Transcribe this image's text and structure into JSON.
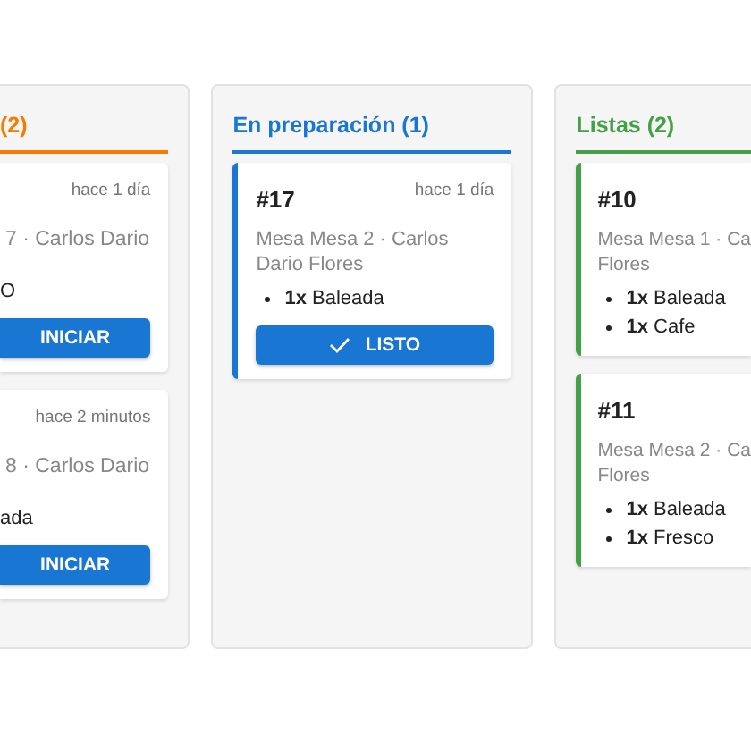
{
  "columns": [
    {
      "title": "(2)",
      "color": "#f57c00",
      "kind": "cut-left",
      "cards": [
        {
          "time": "hace 1 día",
          "table": "7 · Carlos Dario",
          "items": [
            {
              "text": "O",
              "bullet": false
            }
          ],
          "action": {
            "label": "INICIAR",
            "kind": "start"
          }
        },
        {
          "time": "hace 2 minutos",
          "table": "8 · Carlos Dario",
          "items": [
            {
              "text": "ada",
              "bullet": false
            }
          ],
          "action": {
            "label": "INICIAR",
            "kind": "start"
          }
        }
      ]
    },
    {
      "title": "En preparación (1)",
      "color": "#1976d2",
      "kind": "full",
      "cards": [
        {
          "number": "#17",
          "time": "hace 1 día",
          "table": "Mesa Mesa 2 · Carlos Dario Flores",
          "items": [
            {
              "text": "**1x** Baleada",
              "bullet": true
            }
          ],
          "action": {
            "label": "LISTO",
            "kind": "done"
          }
        }
      ]
    },
    {
      "title": "Listas (2)",
      "color": "#43a047",
      "kind": "cut-right",
      "cards": [
        {
          "number": "#10",
          "table": "Mesa Mesa 1 · Ca",
          "table_line2": "Flores",
          "items": [
            {
              "text": "**1x** Baleada",
              "bullet": true
            },
            {
              "text": "**1x** Cafe",
              "bullet": true
            }
          ]
        },
        {
          "number": "#11",
          "table": "Mesa Mesa 2 · Ca",
          "table_line2": "Flores",
          "items": [
            {
              "text": "**1x** Baleada",
              "bullet": true
            },
            {
              "text": "**1x** Fresco",
              "bullet": true
            }
          ]
        }
      ]
    }
  ]
}
